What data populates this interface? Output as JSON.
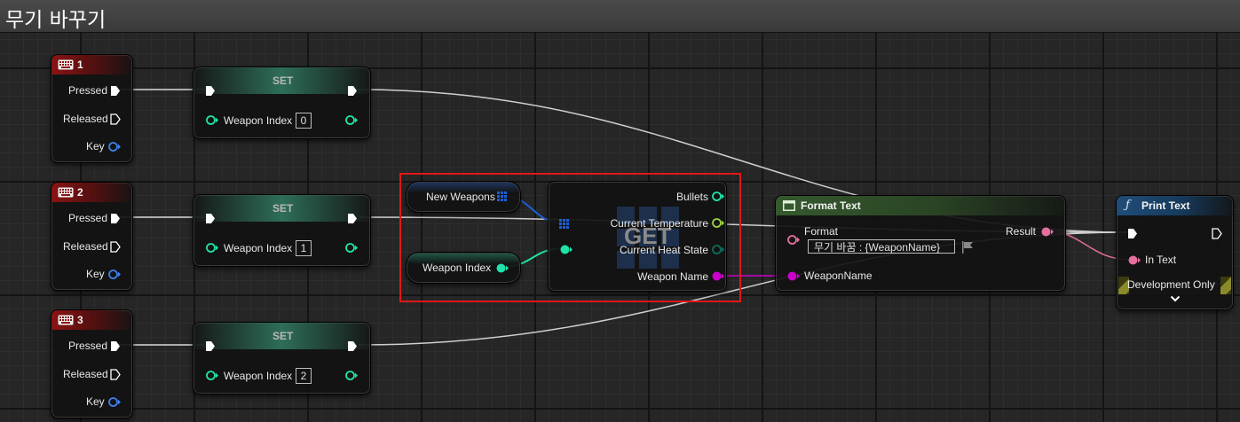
{
  "window": {
    "title": "무기 바꾸기"
  },
  "events": [
    {
      "key_label": "1",
      "pins": {
        "pressed": "Pressed",
        "released": "Released",
        "key": "Key"
      }
    },
    {
      "key_label": "2",
      "pins": {
        "pressed": "Pressed",
        "released": "Released",
        "key": "Key"
      }
    },
    {
      "key_label": "3",
      "pins": {
        "pressed": "Pressed",
        "released": "Released",
        "key": "Key"
      }
    }
  ],
  "set_nodes": [
    {
      "title": "SET",
      "var_label": "Weapon Index",
      "value": "0"
    },
    {
      "title": "SET",
      "var_label": "Weapon Index",
      "value": "1"
    },
    {
      "title": "SET",
      "var_label": "Weapon Index",
      "value": "2"
    }
  ],
  "variables": {
    "new_weapons": "New Weapons",
    "weapon_index": "Weapon Index"
  },
  "get_node": {
    "watermark": "GET",
    "outputs": [
      "Bullets",
      "Current Temperature",
      "Current Heat State",
      "Weapon Name"
    ]
  },
  "format_text": {
    "title": "Format Text",
    "format_label": "Format",
    "format_value": "무기 바꿈 : {WeaponName}",
    "result_label": "Result",
    "arg_label": "WeaponName"
  },
  "print_text": {
    "title": "Print Text",
    "title_icon": "function-icon",
    "in_text_label": "In Text",
    "dev_label": "Development Only"
  },
  "colors": {
    "exec": "#ffffff",
    "int": "#1fe3a9",
    "text": "#e76fa0",
    "name": "#cc00cc",
    "struct_array": "#1b5fd6",
    "key": "#3e7fe8",
    "highlight": "#e01818"
  }
}
